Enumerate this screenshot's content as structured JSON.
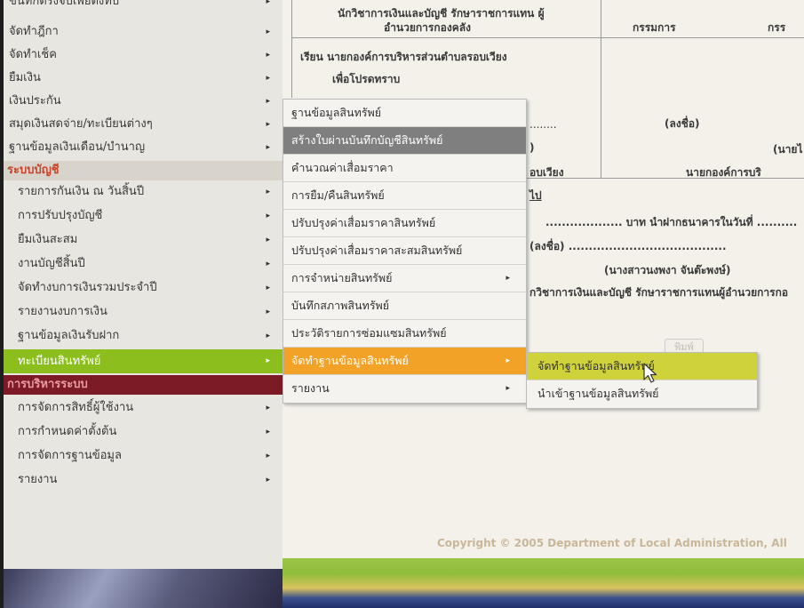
{
  "sidebar": {
    "top_items": [
      {
        "label": "ขนทกตรงจบเพยตงทบ",
        "arrow": "▸"
      },
      {
        "label": "จัดทำฎีกา",
        "arrow": "▸"
      },
      {
        "label": "จัดทำเช็ค",
        "arrow": "▸"
      },
      {
        "label": "ยืมเงิน",
        "arrow": "▸"
      },
      {
        "label": "เงินประกัน",
        "arrow": "▸"
      },
      {
        "label": "สมุดเงินสดจ่าย/ทะเบียนต่างๆ",
        "arrow": "▸"
      },
      {
        "label": "ฐานข้อมูลเงินเดือน/บำนาญ",
        "arrow": "▸"
      }
    ],
    "section_accounting": "ระบบบัญชี",
    "accounting_items": [
      {
        "label": "รายการกันเงิน ณ วันสิ้นปี",
        "arrow": "▸"
      },
      {
        "label": "การปรับปรุงบัญชี",
        "arrow": "▸"
      },
      {
        "label": "ยืมเงินสะสม",
        "arrow": "▸"
      },
      {
        "label": "งานบัญชีสิ้นปี",
        "arrow": "▸"
      },
      {
        "label": "จัดทำงบการเงินรวมประจำปี",
        "arrow": "▸"
      },
      {
        "label": "รายงานงบการเงิน",
        "arrow": "▸"
      },
      {
        "label": "ฐานข้อมูลเงินรับฝาก",
        "arrow": "▸"
      },
      {
        "label": "ทะเบียนสินทรัพย์",
        "arrow": "▸"
      }
    ],
    "section_admin": "การบริหารระบบ",
    "admin_items": [
      {
        "label": "การจัดการสิทธิ์ผู้ใช้งาน",
        "arrow": "▸"
      },
      {
        "label": "การกำหนดค่าตั้งต้น",
        "arrow": "▸"
      },
      {
        "label": "การจัดการฐานข้อมูล",
        "arrow": "▸"
      },
      {
        "label": "รายงาน",
        "arrow": "▸"
      }
    ]
  },
  "document": {
    "line1": "นักวิชาการเงินและบัญชี รักษาราชการแทน ผู้",
    "line2": "อำนวยการกองคลัง",
    "committee": "กรรมการ",
    "committee2": "กรร",
    "to_line": "เรียน นายกองค์การบริหารส่วนตำบลรอบเวียง",
    "for_info": "เพื่อโปรดทราบ",
    "dots1": "........",
    "sign1": "(ลงชื่อ)",
    "bracket1": ")",
    "name_partial": "(นายไ",
    "org_partial": "อบเวียง",
    "mayor_partial": "นายกองค์การบริ",
    "to_partial": "ไป",
    "deposit_line": "................... บาท นำฝากธนาคารในวันที่ ..........",
    "sign2": "(ลงชื่อ) .......................................",
    "signer_name": "(นางสาวนงพงา จันต๊ะพงษ์)",
    "signer_title": "กวิชาการเงินและบัญชี รักษาราชการแทนผู้อำนวยการกอ",
    "print_label": "พิมพ์"
  },
  "menu": {
    "items": [
      {
        "label": "ฐานข้อมูลสินทรัพย์",
        "arrow": ""
      },
      {
        "label": "สร้างใบผ่านบันทึกบัญชีสินทรัพย์",
        "arrow": ""
      },
      {
        "label": "คำนวณค่าเสื่อมราคา",
        "arrow": ""
      },
      {
        "label": "การยืม/คืนสินทรัพย์",
        "arrow": ""
      },
      {
        "label": "ปรับปรุงค่าเสื่อมราคาสินทรัพย์",
        "arrow": ""
      },
      {
        "label": "ปรับปรุงค่าเสื่อมราคาสะสมสินทรัพย์",
        "arrow": ""
      },
      {
        "label": "การจำหน่ายสินทรัพย์",
        "arrow": "▸"
      },
      {
        "label": "บันทึกสภาพสินทรัพย์",
        "arrow": ""
      },
      {
        "label": "ประวัติรายการซ่อมแซมสินทรัพย์",
        "arrow": ""
      },
      {
        "label": "จัดทำฐานข้อมูลสินทรัพย์",
        "arrow": "▸"
      },
      {
        "label": "รายงาน",
        "arrow": "▸"
      }
    ],
    "submenu": [
      {
        "label": "จัดทำฐานข้อมูลสินทรัพย์"
      },
      {
        "label": "นำเข้าฐานข้อมูลสินทรัพย์"
      }
    ]
  },
  "footer": {
    "copyright": "Copyright © 2005 Department of Local Administration, All"
  },
  "colors": {
    "active_green": "#8cbf1e",
    "menu_hover_orange": "#f1a227",
    "menu_selected_gray": "#7f7f7f",
    "submenu_highlight": "#cfd23a",
    "section_head_red": "#c7462b",
    "admin_head_bg": "#7c1a25"
  },
  "icons": {
    "cursor": "mouse-pointer-icon",
    "arrow": "triangle-right-icon"
  }
}
